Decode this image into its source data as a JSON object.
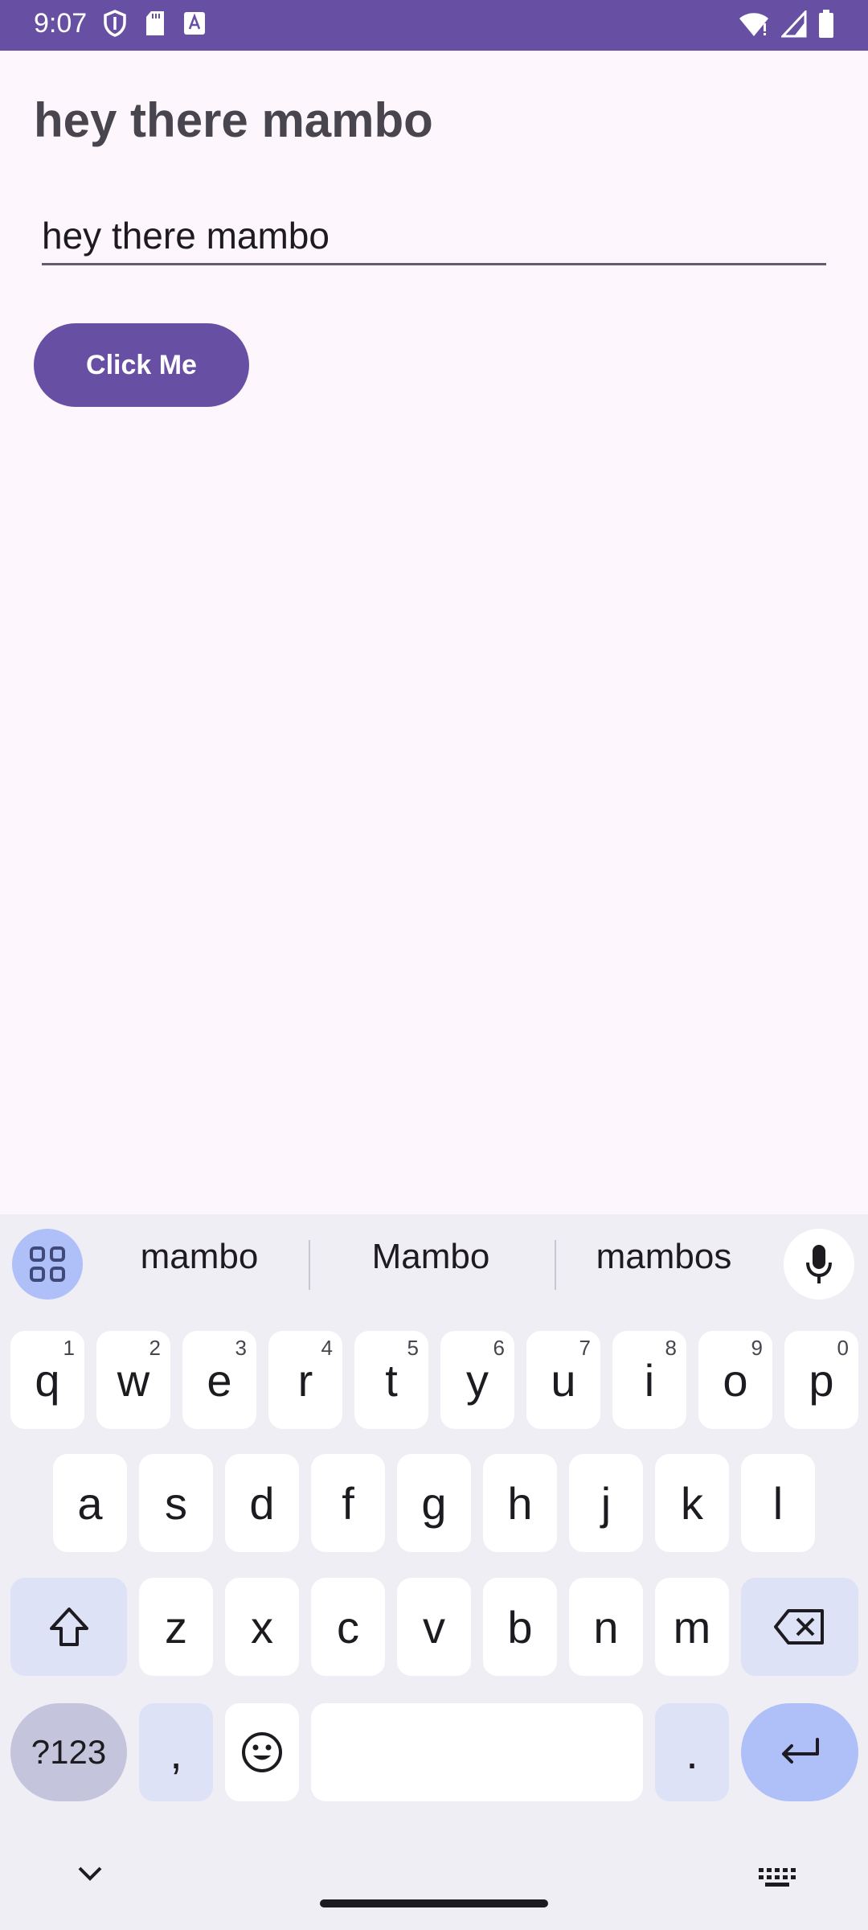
{
  "status_bar": {
    "time": "9:07",
    "left_icons": [
      "shield-icon",
      "sd-card-icon",
      "font-icon"
    ],
    "right_icons": [
      "wifi-icon",
      "signal-icon",
      "battery-icon"
    ],
    "color": "#6750a4"
  },
  "app": {
    "title": "hey there mambo",
    "input_value": "hey there mambo",
    "button_label": "Click Me",
    "accent": "#6750a4"
  },
  "keyboard": {
    "suggestions": [
      "mambo",
      "Mambo",
      "mambos"
    ],
    "row1": [
      {
        "key": "q",
        "hint": "1"
      },
      {
        "key": "w",
        "hint": "2"
      },
      {
        "key": "e",
        "hint": "3"
      },
      {
        "key": "r",
        "hint": "4"
      },
      {
        "key": "t",
        "hint": "5"
      },
      {
        "key": "y",
        "hint": "6"
      },
      {
        "key": "u",
        "hint": "7"
      },
      {
        "key": "i",
        "hint": "8"
      },
      {
        "key": "o",
        "hint": "9"
      },
      {
        "key": "p",
        "hint": "0"
      }
    ],
    "row2": [
      "a",
      "s",
      "d",
      "f",
      "g",
      "h",
      "j",
      "k",
      "l"
    ],
    "row3": [
      "z",
      "x",
      "c",
      "v",
      "b",
      "n",
      "m"
    ],
    "symbols_label": "?123",
    "comma": ",",
    "period": "."
  }
}
